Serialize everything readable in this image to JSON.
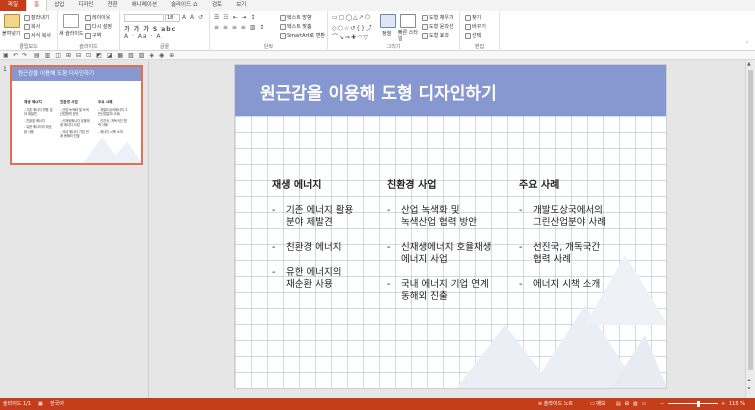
{
  "tabs": [
    {
      "label": "파일",
      "kind": "file"
    },
    {
      "label": "홈",
      "kind": "active"
    },
    {
      "label": "삽입"
    },
    {
      "label": "디자인"
    },
    {
      "label": "전환"
    },
    {
      "label": "애니메이션"
    },
    {
      "label": "슬라이드 쇼"
    },
    {
      "label": "검토"
    },
    {
      "label": "보기"
    }
  ],
  "ribbon": {
    "clipboard": {
      "label": "클립보드",
      "paste": "붙여넣기",
      "cut": "잘라내기",
      "copy": "복사",
      "format_painter": "서식 복사"
    },
    "slides": {
      "label": "슬라이드",
      "new_slide": "새 슬라이드",
      "layout": "레이아웃",
      "reset": "다시 설정",
      "section": "구역"
    },
    "font": {
      "label": "글꼴",
      "name_value": "",
      "size_value": "18"
    },
    "paragraph": {
      "label": "단락",
      "text_direction": "텍스트 방향",
      "align_text": "텍스트 맞춤",
      "smartart": "SmartArt로 변환"
    },
    "drawing": {
      "label": "그리기",
      "arrange": "정렬",
      "quick_styles": "빠른 스타일",
      "shape_fill": "도형 채우기",
      "shape_outline": "도형 윤곽선",
      "shape_effects": "도형 효과"
    },
    "editing": {
      "label": "편집",
      "find": "찾기",
      "replace": "바꾸기",
      "select": "선택"
    }
  },
  "thumbnail": {
    "number": "1",
    "title": "원근감을 이용해 도형 디자인하기",
    "columns": [
      {
        "head": "재생 에너지",
        "items": [
          "- 기존 에너지 활용 분야 제발견",
          "- 친환경 에너지",
          "- 유한 에너지의 재순환 사용"
        ]
      },
      {
        "head": "친환경 사업",
        "items": [
          "- 산업 녹색화 및 녹색산업협력 방안",
          "- 신재생에너지 호율재생 에너지 사업",
          "- 국내 에너지 기업 연계 동해외 진출"
        ]
      },
      {
        "head": "주요 사례",
        "items": [
          "- 개발도상국에서의 그린산업분야 사례",
          "- 선진국, 개독국간 협력 사례",
          "- 에너지 시책 소개"
        ]
      }
    ]
  },
  "slide": {
    "title": "원근감을 이용해 도형 디자인하기",
    "columns": [
      {
        "head": "재생 에너지",
        "items": [
          "기존 에너지 활용\n분야 제발견",
          "친환경 에너지",
          "유한 에너지의\n재순환 사용"
        ]
      },
      {
        "head": "친환경 사업",
        "items": [
          "산업 녹색화 및\n녹색산업 협력 방안",
          "신재생에너지 호율재생\n에너지 사업",
          "국내 에너지 기업 연계\n동해외 진출"
        ]
      },
      {
        "head": "주요 사례",
        "items": [
          "개발도상국에서의\n그린산업분야 사례",
          "선진국, 개독국간\n협력 사례",
          "에너지 시책 소개"
        ]
      }
    ]
  },
  "status": {
    "slide_info": "슬라이드 1/1",
    "language": "한국어",
    "notes": "슬라이드 노트",
    "comments": "메모",
    "zoom": "115 %"
  },
  "colors": {
    "accent": "#c43e1c",
    "title_band": "#8797cf"
  }
}
